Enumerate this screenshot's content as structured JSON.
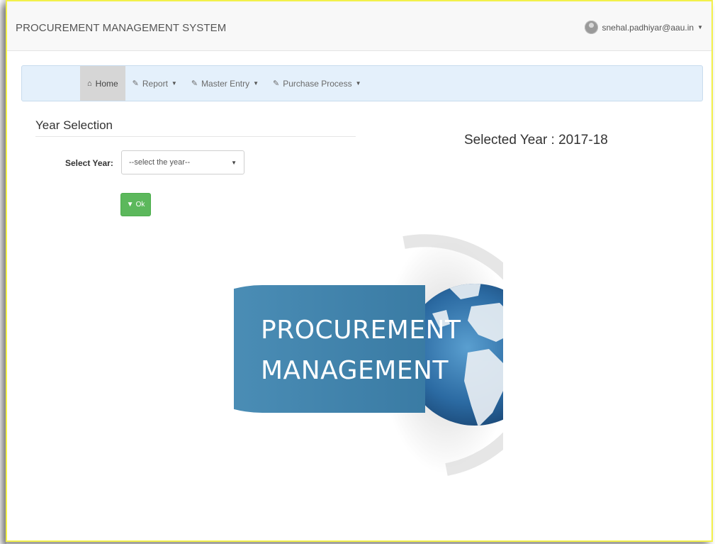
{
  "app": {
    "title": "PROCUREMENT MANAGEMENT SYSTEM",
    "user_email": "snehal.padhiyar@aau.in"
  },
  "nav": {
    "items": [
      {
        "label": "Home",
        "icon": "home-icon",
        "active": true
      },
      {
        "label": "Report",
        "icon": "edit-icon",
        "dropdown": true
      },
      {
        "label": "Master Entry",
        "icon": "edit-icon",
        "dropdown": true
      },
      {
        "label": "Purchase Process",
        "icon": "edit-icon",
        "dropdown": true
      }
    ]
  },
  "year_panel": {
    "title": "Year Selection",
    "label": "Select Year:",
    "select_value": "--select the year--",
    "ok_label": "Ok"
  },
  "selected_year_text": "Selected Year : 2017-18",
  "logo": {
    "line1": "PROCUREMENT",
    "line2": "MANAGEMENT"
  },
  "colors": {
    "navbar_bg": "#e4f0fb",
    "ok_button": "#5cb85c",
    "logo_banner": "#3f86ad",
    "globe_blue": "#2f6ea5"
  }
}
